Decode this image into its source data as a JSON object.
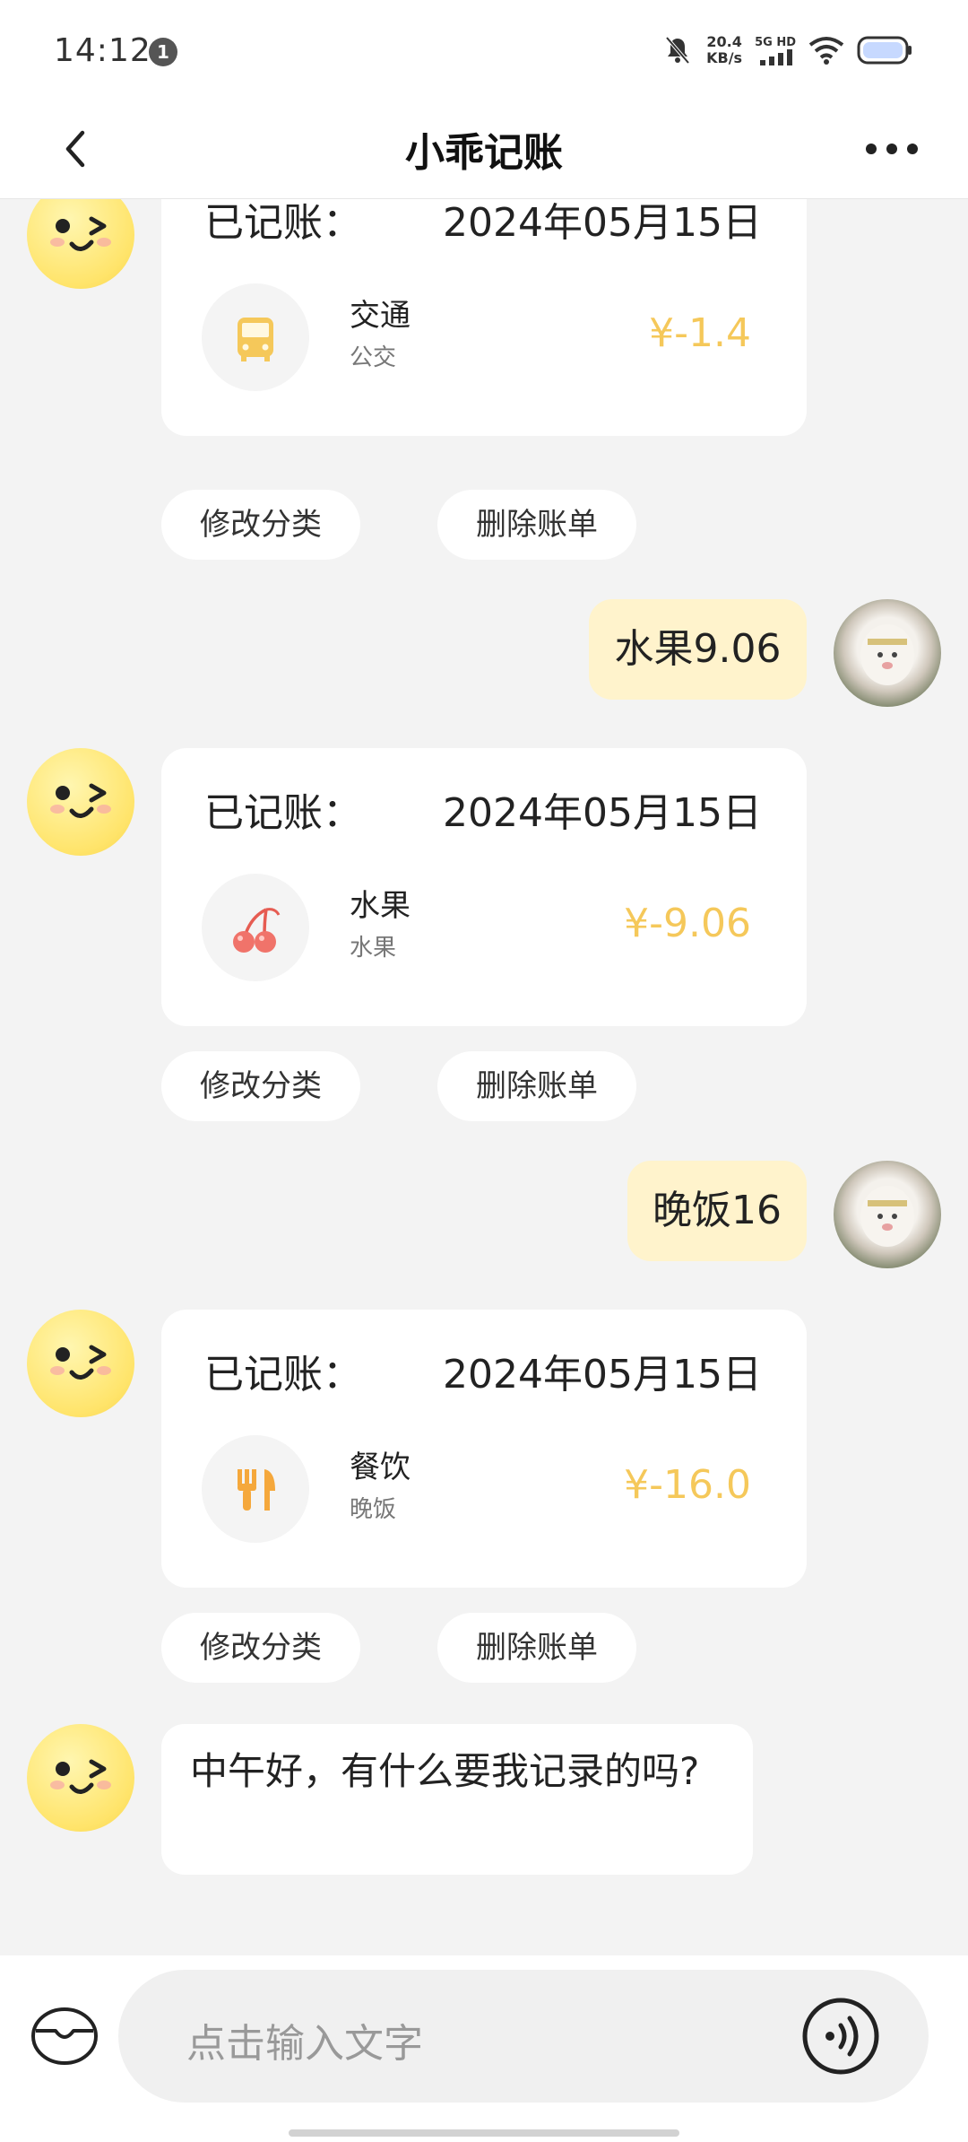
{
  "status_bar": {
    "time": "14:12",
    "notification_count": "1",
    "net_speed_value": "20.4",
    "net_speed_unit": "KB/s",
    "network_type": "5G HD"
  },
  "header": {
    "title": "小乖记账",
    "back_icon": "chevron-left-icon",
    "more_icon": "more-dots-icon"
  },
  "chat": {
    "records": [
      {
        "label": "已记账：",
        "date": "2024年05月15日",
        "category": "交通",
        "note": "公交",
        "amount": "¥-1.4",
        "icon": "bus-icon",
        "icon_color": "#f5c85a",
        "edit_label": "修改分类",
        "delete_label": "删除账单"
      },
      {
        "label": "已记账：",
        "date": "2024年05月15日",
        "category": "水果",
        "note": "水果",
        "amount": "¥-9.06",
        "icon": "cherry-icon",
        "icon_color": "#f0736a",
        "edit_label": "修改分类",
        "delete_label": "删除账单"
      },
      {
        "label": "已记账：",
        "date": "2024年05月15日",
        "category": "餐饮",
        "note": "晚饭",
        "amount": "¥-16.0",
        "icon": "fork-knife-icon",
        "icon_color": "#f5a83c",
        "edit_label": "修改分类",
        "delete_label": "删除账单"
      }
    ],
    "user_messages": [
      "水果9.06",
      "晚饭16"
    ],
    "bot_message": "中午好，有什么要我记录的吗?"
  },
  "input_bar": {
    "placeholder": "点击输入文字",
    "wallet_icon": "wallet-icon",
    "voice_icon": "voice-icon"
  },
  "colors": {
    "accent_yellow": "#f5c85a",
    "user_bubble": "#fff3cc",
    "background": "#f3f3f3"
  }
}
